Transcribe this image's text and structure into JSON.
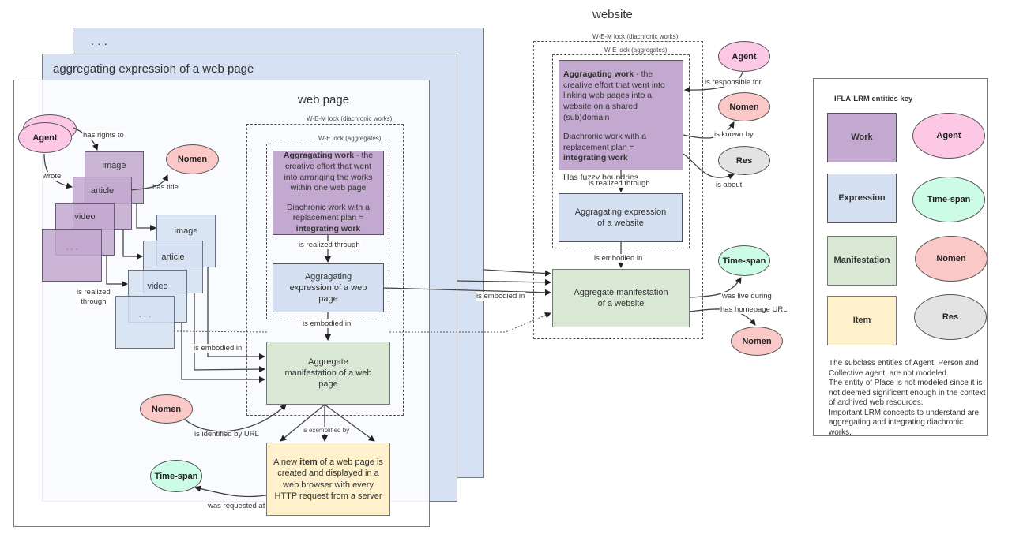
{
  "panels": {
    "back_title": ". . .",
    "middle_title": "aggregating expression of a web page",
    "front_title": "web page"
  },
  "webpage": {
    "wem_lock_label": "W-E-M lock (diachronic works)",
    "we_lock_label": "W-E lock (aggregates)",
    "work": {
      "bold": "Aggragating work",
      "text1": " - the creative effort that went into arranging the works within one web page",
      "text2": "Diachronic work with a replacement plan = ",
      "text2_bold": "integrating work"
    },
    "realized_label": "is realized through",
    "expression": "Aggragating expression of a web page",
    "embodied_label": "is embodied in",
    "manifestation": "Aggregate manifestation of a web page",
    "exemplified_label": "is exemplified by",
    "item": {
      "pre": "A new ",
      "bold": "item",
      "post": " of a web page is created and displayed in a web browser with every HTTP request from a server"
    },
    "agent": "Agent",
    "has_rights_label": "has rights to",
    "wrote_label": "wrote",
    "nomen_title": "Nomen",
    "has_title_label": "has title",
    "component_works": [
      "image",
      "article",
      "video",
      ". . ."
    ],
    "component_expressions": [
      "image",
      "article",
      "video",
      ". . ."
    ],
    "components_realized_label": "is realized\nthrough",
    "components_embodied_label": "is embodied in",
    "nomen_url": "Nomen",
    "identified_label": "is identified by URL",
    "timespan": "Time-span",
    "requested_label": "was requested at"
  },
  "website": {
    "title": "website",
    "wem_lock_label": "W-E-M lock (diachronic works)",
    "we_lock_label": "W-E lock (aggregates)",
    "work": {
      "bold": "Aggragating work",
      "text1": " - the creative effort that went into linking web pages into a website on a shared (sub)domain",
      "text2": "Diachronic work with a replacement plan = ",
      "text2_bold": "integrating work",
      "text3": "Has fuzzy boundries"
    },
    "realized_label": "is realized through",
    "expression": "Aggragating expression of a website",
    "embodied_label": "is embodied in",
    "manifestation": "Aggregate manifestation of a website",
    "incoming_embodied_label": "is embodied in",
    "agent": "Agent",
    "responsible_label": "is responsible for",
    "nomen": "Nomen",
    "known_label": "is known by",
    "res": "Res",
    "about_label": "is about",
    "timespan": "Time-span",
    "live_label": "was live during",
    "nomen_url": "Nomen",
    "homepage_label": "has homepage URL"
  },
  "key": {
    "title": "IFLA-LRM entities key",
    "work": "Work",
    "expression": "Expression",
    "manifestation": "Manifestation",
    "item": "Item",
    "agent": "Agent",
    "timespan": "Time-span",
    "nomen": "Nomen",
    "res": "Res",
    "note": "The subclass entities of Agent, Person and Collective agent, are not modeled.\nThe entity of Place is not modeled since it is not deemed significent enough in the context of archived web resources.\nImportant LRM concepts to understand are aggregating and integrating diachronic works."
  },
  "colors": {
    "work": "#c3a8cf",
    "expression": "#d5e1f2",
    "manifestation": "#d8e8d5",
    "item": "#fef1cc",
    "agent": "#fdc7e6",
    "nomen": "#fbc8c8",
    "timespan": "#ccfce6",
    "res": "#e3e3e3"
  }
}
